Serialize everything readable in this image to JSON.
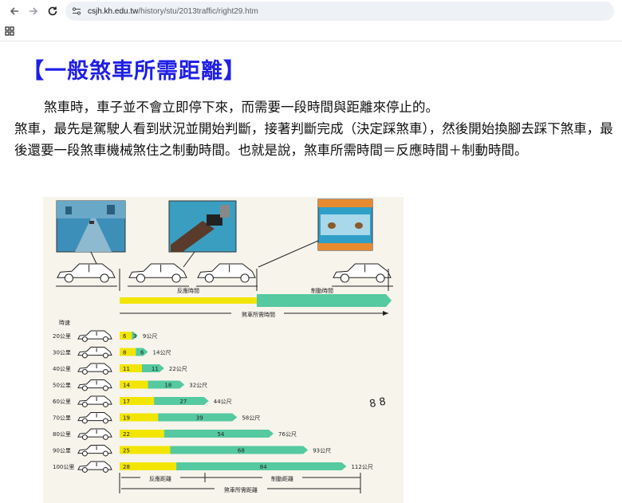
{
  "browser": {
    "url_host": "csjh.kh.edu.tw",
    "url_path": "/history/stu/2013traffic/right29.htm",
    "icons": [
      "back-arrow-icon",
      "forward-arrow-icon",
      "reload-icon",
      "site-settings-icon",
      "apps-grid-icon"
    ]
  },
  "page": {
    "title": "【一般煞車所需距離】",
    "para_line1": "煞車時，車子並不會立即停下來，而需要一段時間與距離來停止的。",
    "para_rest": "煞車，最先是駕駛人看到狀況並開始判斷，接著判斷完成（決定踩煞車），然後開始換腳去踩下煞車，最後還要一段煞車機械煞住之制動時間。也就是說，煞車所需時間＝反應時間＋制動時間。"
  },
  "chart_data": {
    "type": "bar",
    "stacked": true,
    "orientation": "horizontal",
    "top_labels": {
      "reaction_time": "反應時間",
      "braking_time": "制動時間",
      "total_time": "煞車所需時間"
    },
    "y_header": "時速",
    "categories": [
      "20公里",
      "30公里",
      "40公里",
      "50公里",
      "60公里",
      "70公里",
      "80公里",
      "90公里",
      "100公里"
    ],
    "series": [
      {
        "values": [
          6,
          8,
          11,
          14,
          17,
          19,
          22,
          25,
          28
        ],
        "color": "#f2e600"
      },
      {
        "values": [
          3,
          6,
          11,
          18,
          27,
          39,
          54,
          68,
          84
        ],
        "color": "#55c9a0"
      }
    ],
    "totals": [
      "9公尺",
      "14公尺",
      "22公尺",
      "32公尺",
      "44公尺",
      "58公尺",
      "76公尺",
      "93公尺",
      "112公尺"
    ],
    "bottom_labels": {
      "reaction_distance": "反應距離",
      "braking_distance": "制動距離",
      "total_distance": "煞車所需距離"
    },
    "annotation": "8 8"
  }
}
